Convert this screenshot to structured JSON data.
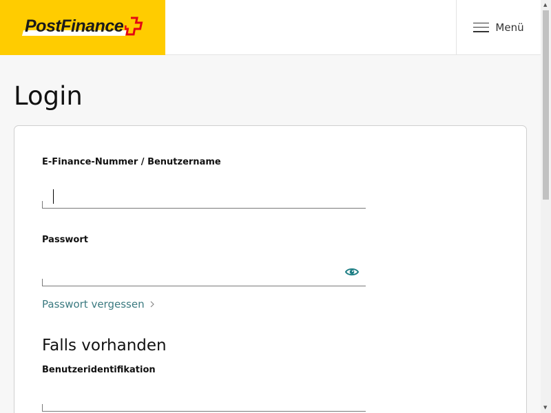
{
  "header": {
    "logo_text": "PostFinance",
    "menu_label": "Menü"
  },
  "page_title": "Login",
  "form": {
    "username_label": "E-Finance-Nummer / Benutzername",
    "username_value": "",
    "password_label": "Passwort",
    "password_value": "",
    "forgot_link": "Passwort vergessen",
    "section_title": "Falls vorhanden",
    "userid_label": "Benutzeridentifikation",
    "userid_value": ""
  },
  "colors": {
    "brand_yellow": "#ffcc00",
    "accent_teal": "#1f7f85",
    "cross_red": "#e30613"
  }
}
